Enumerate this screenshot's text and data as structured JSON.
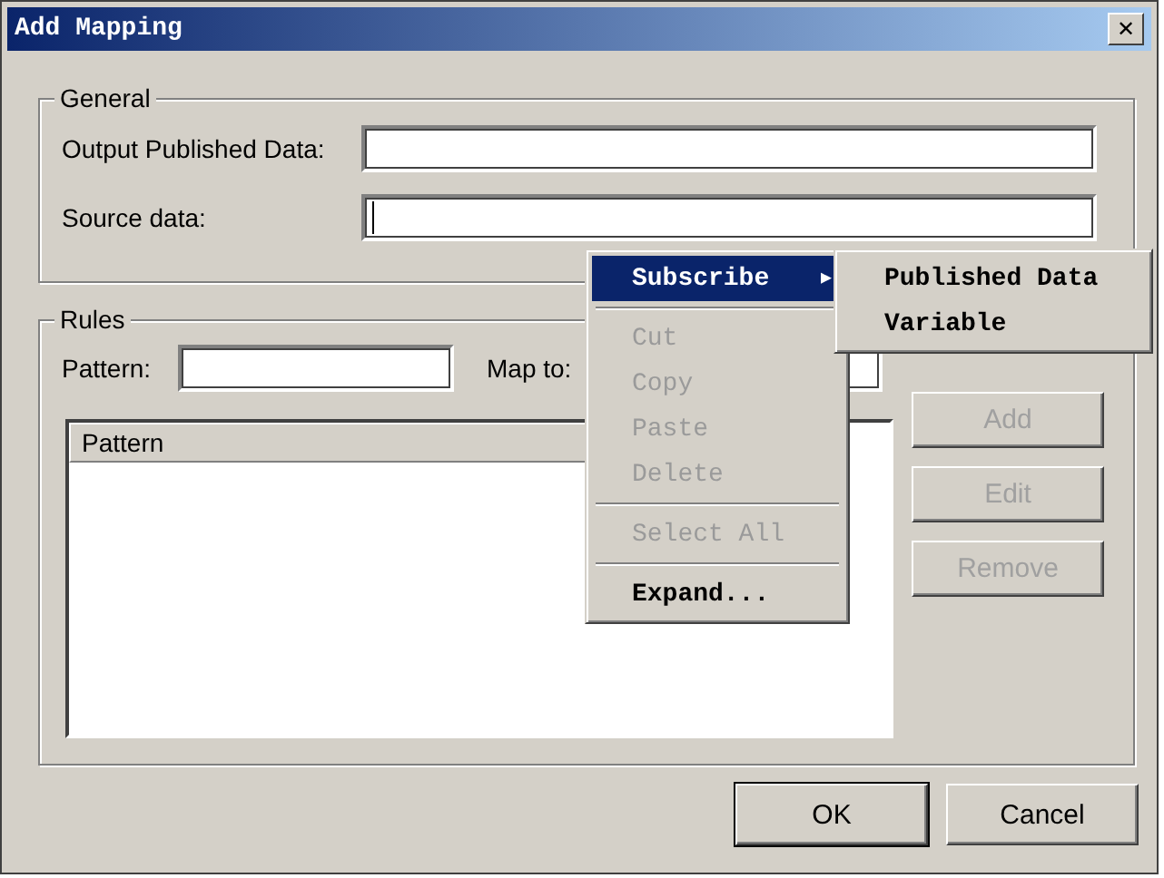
{
  "window": {
    "title": "Add Mapping",
    "close": "✕"
  },
  "general": {
    "title": "General",
    "fields": [
      {
        "label": "Output Published Data:"
      },
      {
        "label": "Source data:",
        "focused": true
      }
    ]
  },
  "rules": {
    "title": "Rules",
    "pattern_label": "Pattern:",
    "map_label": "Map to:",
    "columns": [
      "Pattern"
    ],
    "buttons": [
      {
        "label": "Add",
        "disabled": true
      },
      {
        "label": "Edit",
        "disabled": true
      },
      {
        "label": "Remove",
        "disabled": true
      }
    ]
  },
  "buttons": [
    {
      "label": "OK",
      "default": true
    },
    {
      "label": "Cancel",
      "default": false
    }
  ],
  "context_menu": {
    "items": [
      {
        "kind": "submenu",
        "label": "Subscribe",
        "arrow": "▶",
        "disabled": false,
        "selected": true
      },
      {
        "kind": "separator"
      },
      {
        "kind": "item",
        "label": "Cut",
        "disabled": true,
        "selected": false
      },
      {
        "kind": "item",
        "label": "Copy",
        "disabled": true,
        "selected": false
      },
      {
        "kind": "item",
        "label": "Paste",
        "disabled": true,
        "selected": false
      },
      {
        "kind": "item",
        "label": "Delete",
        "disabled": true,
        "selected": false
      },
      {
        "kind": "separator"
      },
      {
        "kind": "item",
        "label": "Select All",
        "disabled": true,
        "selected": false
      },
      {
        "kind": "separator"
      },
      {
        "kind": "item",
        "label": "Expand...",
        "disabled": false,
        "selected": false
      }
    ]
  },
  "submenu": {
    "items": [
      {
        "label": "Published Data",
        "selected": false
      },
      {
        "label": "Variable",
        "selected": false
      }
    ]
  }
}
